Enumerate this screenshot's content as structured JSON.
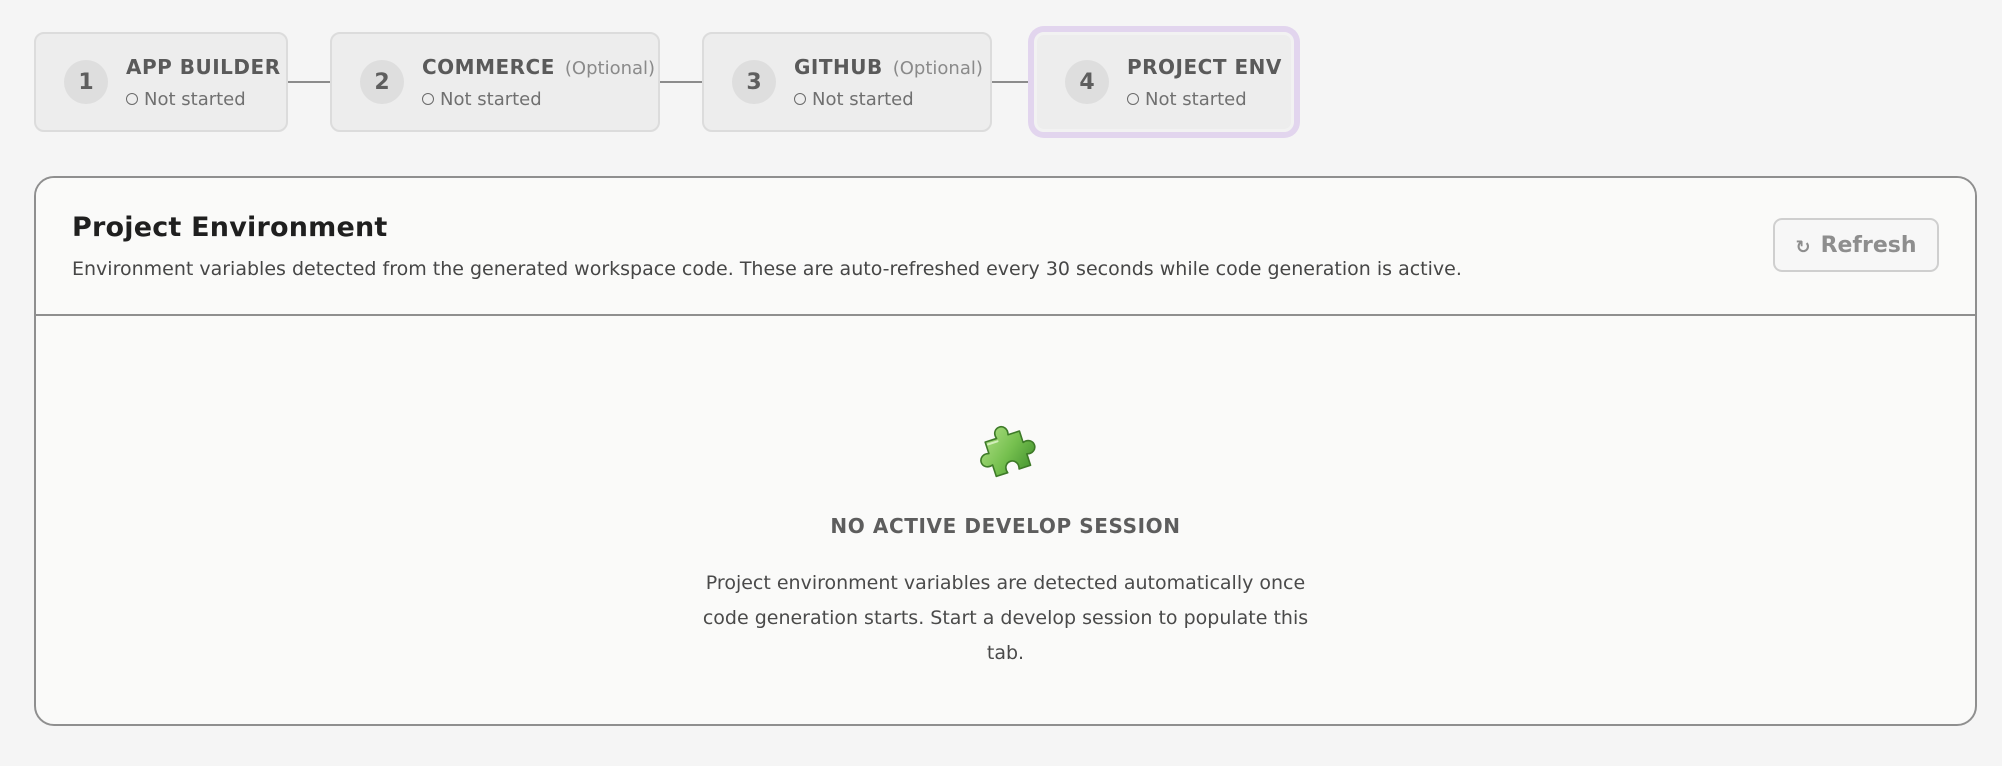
{
  "stepper": {
    "steps": [
      {
        "number": "1",
        "title": "APP BUILDER",
        "optional": "",
        "status": "Not started",
        "active": false
      },
      {
        "number": "2",
        "title": "COMMERCE",
        "optional": "(Optional)",
        "status": "Not started",
        "active": false
      },
      {
        "number": "3",
        "title": "GITHUB",
        "optional": "(Optional)",
        "status": "Not started",
        "active": false
      },
      {
        "number": "4",
        "title": "PROJECT ENV",
        "optional": "",
        "status": "Not started",
        "active": true
      }
    ]
  },
  "panel": {
    "title": "Project Environment",
    "description": "Environment variables detected from the generated workspace code. These are auto-refreshed every 30 seconds while code generation is active.",
    "refresh_icon": "↻",
    "refresh_label": "Refresh"
  },
  "empty_state": {
    "icon": "puzzle-piece-icon",
    "title": "NO ACTIVE DEVELOP SESSION",
    "body_line1": "Project environment variables are detected automatically once",
    "body_line2": "code generation starts. Start a develop session to populate this tab."
  },
  "colors": {
    "active_step_ring": "#e2d5ee",
    "puzzle_green": "#7cc35a",
    "panel_border": "#8f8f8f"
  }
}
